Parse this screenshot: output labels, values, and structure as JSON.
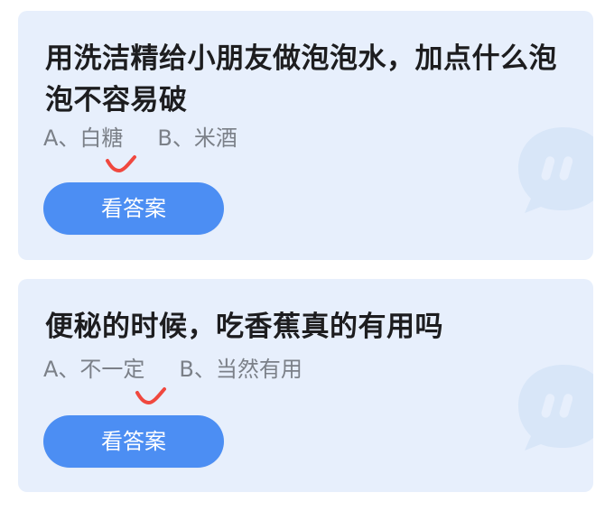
{
  "cards": [
    {
      "question": "用洗洁精给小朋友做泡泡水，加点什么泡泡不容易破",
      "options": [
        "A、白糖",
        "B、米酒"
      ],
      "button_label": "看答案"
    },
    {
      "question": "便秘的时候，吃香蕉真的有用吗",
      "options": [
        "A、不一定",
        "B、当然有用"
      ],
      "button_label": "看答案"
    }
  ],
  "colors": {
    "card_background": "#e7effc",
    "button_background": "#4c8ef3",
    "answer_mark": "#f0483f",
    "question_text": "#1d1d1f",
    "option_text": "#7b8088"
  },
  "icons": {
    "selected_answer": "red-check-mark-icon",
    "decorative_watermark": "chat-bubble-icon"
  }
}
